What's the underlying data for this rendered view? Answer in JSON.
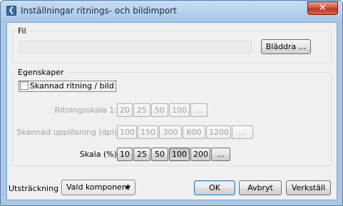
{
  "window": {
    "title": "Inställningar ritnings- och bildimport",
    "app_icon_glyph": "❮",
    "close_glyph": "✕"
  },
  "file_group": {
    "legend": "Fil",
    "path_value": "",
    "browse_label": "Bläddra ..."
  },
  "props_group": {
    "legend": "Egenskaper",
    "scanned_label": "Skannad ritning / bild",
    "scanned_checked": false,
    "drawing_scale": {
      "label": "Ritningsskala 1:",
      "options": [
        "20",
        "25",
        "50",
        "100",
        "..."
      ],
      "enabled": false
    },
    "scan_dpi": {
      "label": "Skannad upplösning (dpi)",
      "options": [
        "100",
        "150",
        "300",
        "600",
        "1200",
        "..."
      ],
      "enabled": false
    },
    "scale_percent": {
      "label": "Skala (%)",
      "options": [
        "10",
        "25",
        "50",
        "100",
        "200",
        "..."
      ],
      "selected": "100",
      "enabled": true
    }
  },
  "footer": {
    "extent_label": "Utsträckning",
    "extent_value": "Vald komponent",
    "ok_label": "OK",
    "cancel_label": "Avbryt",
    "apply_label": "Verkställ"
  }
}
